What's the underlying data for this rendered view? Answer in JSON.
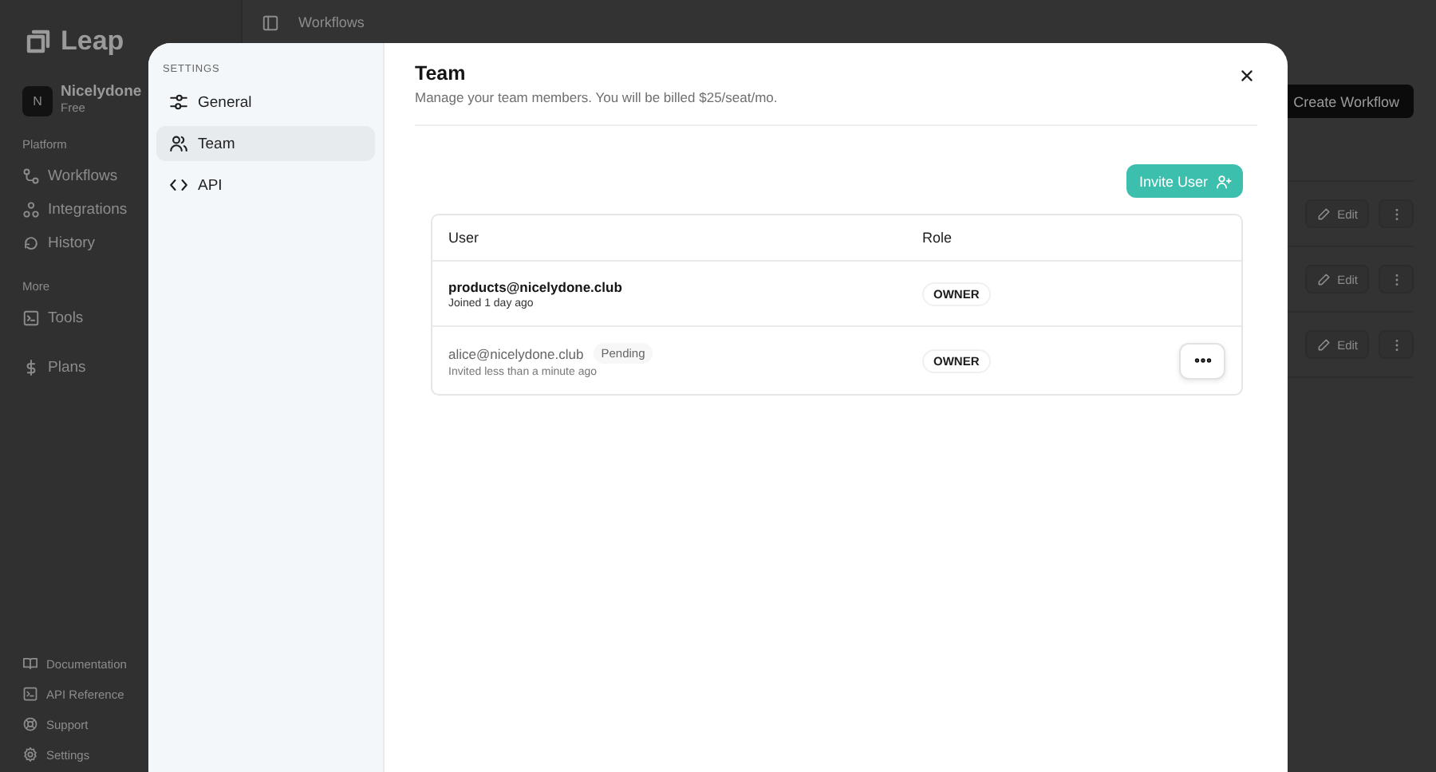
{
  "app": {
    "logo": "Leap",
    "workspace": {
      "initial": "N",
      "name": "Nicelydone",
      "plan": "Free"
    },
    "nav_sections": [
      {
        "heading": "Platform",
        "items": [
          "Workflows",
          "Integrations",
          "History"
        ]
      },
      {
        "heading": "More",
        "items": [
          "Tools"
        ]
      },
      {
        "items": [
          "Plans"
        ]
      }
    ],
    "footer_links": [
      "Documentation",
      "API Reference",
      "Support",
      "Settings"
    ],
    "breadcrumb": "Workflows",
    "create_button": "Create Workflow",
    "rows": [
      {
        "edit": "Edit"
      },
      {
        "edit": "Edit"
      },
      {
        "edit": "Edit"
      }
    ]
  },
  "modal": {
    "settings_heading": "SETTINGS",
    "menu": [
      {
        "label": "General",
        "selected": false
      },
      {
        "label": "Team",
        "selected": true
      },
      {
        "label": "API",
        "selected": false
      }
    ],
    "title": "Team",
    "description": "Manage your team members. You will be billed $25/seat/mo.",
    "invite_button": "Invite User",
    "columns": [
      "User",
      "Role"
    ],
    "members": [
      {
        "email": "products@nicelydone.club",
        "subtitle": "Joined 1 day ago",
        "role": "OWNER",
        "pending": false,
        "hovered": false
      },
      {
        "email": "alice@nicelydone.club",
        "badge": "Pending",
        "subtitle": "Invited less than a minute ago",
        "role": "OWNER",
        "pending": true,
        "hovered": true
      }
    ]
  }
}
